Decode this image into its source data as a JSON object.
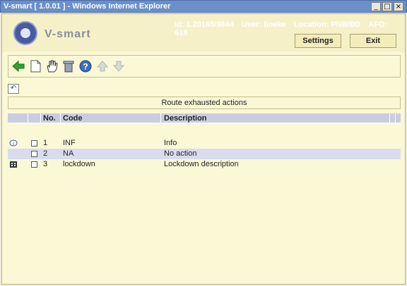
{
  "window": {
    "title": "V-smart [ 1.0.01 ] - Windows Internet Explorer",
    "controls": {
      "minimize": "_",
      "maximize": "□",
      "close": "×"
    }
  },
  "header": {
    "app_name": "V-smart",
    "id_label": "Id: 1.20165/9844",
    "user_label": "User: tineke",
    "location_label": "Location: PNB/BD",
    "afo_label": "AFO: 618",
    "settings_label": "Settings",
    "exit_label": "Exit"
  },
  "toolbar": {
    "icons": [
      "back-arrow-icon",
      "new-document-icon",
      "select-hand-icon",
      "delete-bin-icon",
      "help-icon",
      "move-up-icon",
      "move-down-icon"
    ]
  },
  "undo_button": "↶",
  "section": {
    "title": "Route exhausted actions"
  },
  "table": {
    "columns": {
      "no": "No.",
      "code": "Code",
      "description": "Description"
    },
    "rows": [
      {
        "no": "1",
        "code": "INF",
        "description": "Info",
        "icon": "info-icon"
      },
      {
        "no": "2",
        "code": "NA",
        "description": "No action",
        "icon": ""
      },
      {
        "no": "3",
        "code": "lockdown",
        "description": "Lockdown description",
        "icon": "building-icon"
      }
    ]
  },
  "colors": {
    "titlebar": "#6b8fc8",
    "header_bg": "#f5f0c8",
    "grid_header": "#c9cde0",
    "row_alt": "#d9dcee"
  }
}
